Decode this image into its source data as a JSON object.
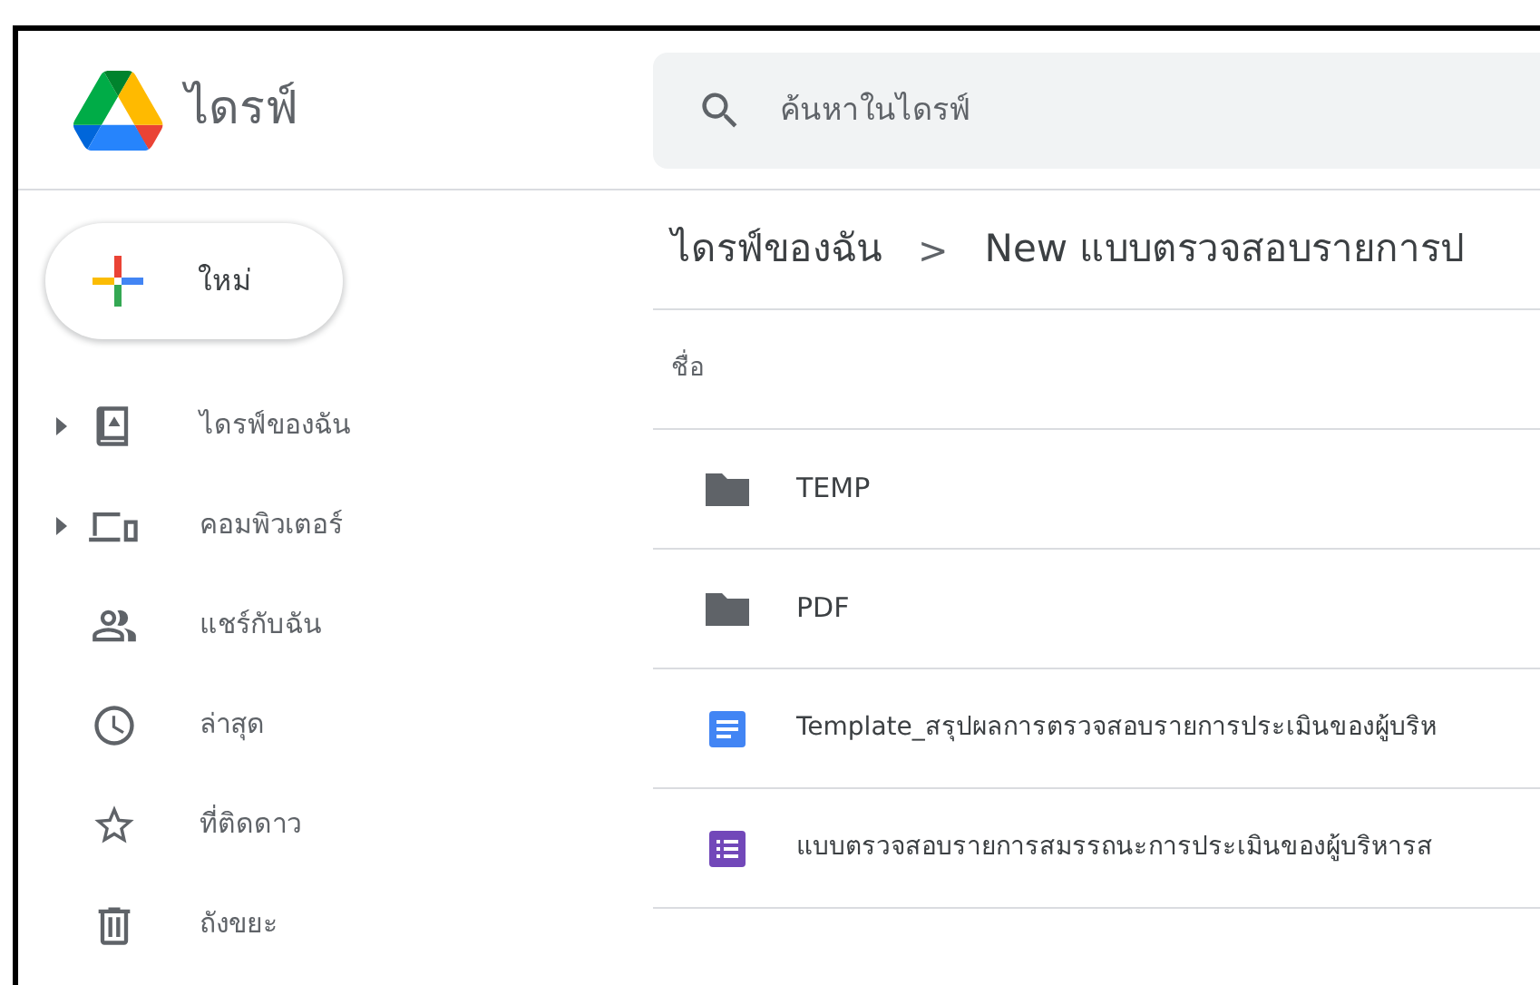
{
  "app": {
    "title": "ไดรฟ์"
  },
  "search": {
    "placeholder": "ค้นหาในไดรฟ์"
  },
  "new_button": {
    "label": "ใหม่"
  },
  "sidebar": {
    "items": [
      {
        "label": "ไดรฟ์ของฉัน",
        "expandable": true
      },
      {
        "label": "คอมพิวเตอร์",
        "expandable": true
      },
      {
        "label": "แชร์กับฉัน",
        "expandable": false
      },
      {
        "label": "ล่าสุด",
        "expandable": false
      },
      {
        "label": "ที่ติดดาว",
        "expandable": false
      },
      {
        "label": "ถังขยะ",
        "expandable": false
      }
    ]
  },
  "breadcrumb": [
    {
      "label": "ไดรฟ์ของฉัน"
    },
    {
      "label": "New แบบตรวจสอบรายการป"
    }
  ],
  "breadcrumb_separator": ">",
  "table": {
    "columns": [
      "ชื่อ"
    ],
    "rows": [
      {
        "name": "TEMP",
        "kind": "folder"
      },
      {
        "name": "PDF",
        "kind": "folder"
      },
      {
        "name": "Template_สรุปผลการตรวจสอบรายการประเมินของผู้บริห",
        "kind": "doc"
      },
      {
        "name": "แบบตรวจสอบรายการสมรรถนะการประเมินของผู้บริหารส",
        "kind": "form"
      }
    ]
  }
}
